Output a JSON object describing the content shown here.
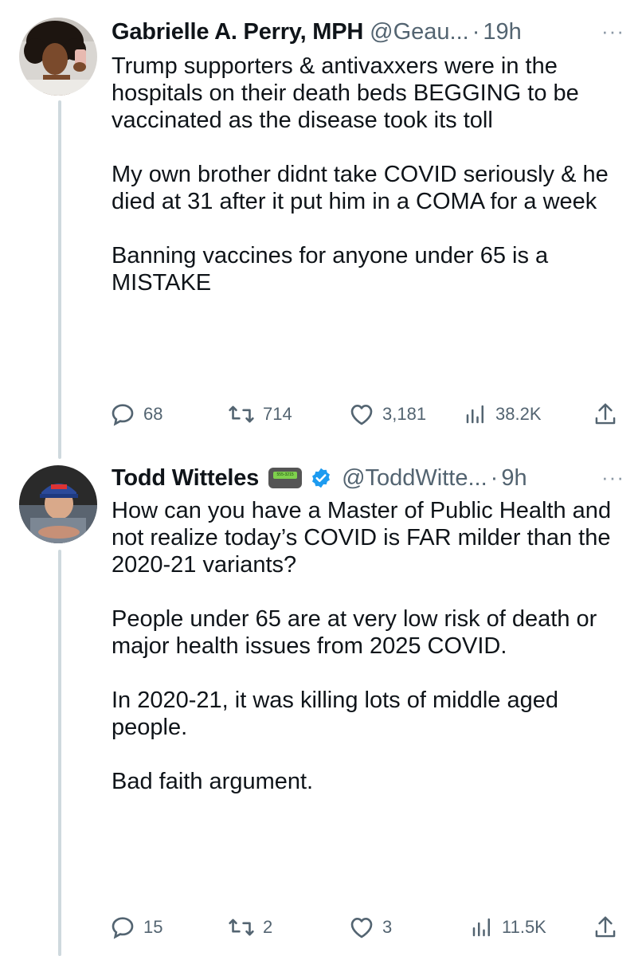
{
  "tweets": [
    {
      "name": "Gabrielle A. Perry, MPH",
      "handle": "@Geau...",
      "sep": "·",
      "time": "19h",
      "more": "···",
      "text": "Trump supporters & antivaxxers were in the hospitals on their death beds BEGGING to be vaccinated as the disease took its toll\n\nMy own brother didnt take COVID seriously & he died at 31 after it put him in a COMA for a week\n\nBanning vaccines for anyone under 65 is a MISTAKE",
      "replies": "68",
      "retweets": "714",
      "likes": "3,181",
      "views": "38.2K"
    },
    {
      "name": "Todd Witteles",
      "pager_text": "555-3215",
      "handle": "@ToddWitte...",
      "sep": "·",
      "time": "9h",
      "more": "···",
      "text": "How can you have a Master of Public Health and not realize today’s COVID is FAR milder than the 2020-21 variants?\n\nPeople under 65 are at very low risk of death or major health issues from 2025 COVID.\n\nIn 2020-21, it was killing lots of middle aged people.\n\nBad faith argument.",
      "replies": "15",
      "retweets": "2",
      "likes": "3",
      "views": "11.5K"
    }
  ],
  "colors": {
    "text": "#0f1419",
    "secondary": "#536471",
    "thread_line": "#cfd9de",
    "verified": "#1d9bf0"
  },
  "icons": [
    "reply-icon",
    "retweet-icon",
    "like-icon",
    "views-icon",
    "share-icon",
    "more-icon",
    "verified-badge-icon",
    "pager-icon"
  ]
}
